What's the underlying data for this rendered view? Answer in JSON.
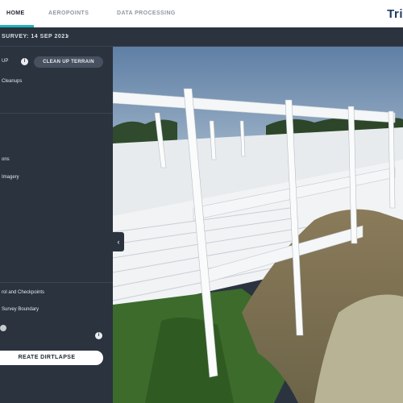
{
  "nav": {
    "tabs": [
      {
        "label": "HOME"
      },
      {
        "label": "AEROPOINTS"
      },
      {
        "label": "DATA PROCESSING"
      }
    ],
    "brand_fragment": "Tri"
  },
  "survey": {
    "label": "SURVEY: 14 SEP 2021",
    "caret": "▾"
  },
  "sidebar": {
    "header_fragment": "UP",
    "cleanup_button": "CLEAN UP TERRAIN",
    "items": [
      {
        "label": "Cleanups"
      },
      {
        "label": "ons"
      },
      {
        "label": "Imagery"
      },
      {
        "label": "rol and Checkpoints"
      },
      {
        "label": "Survey Boundary"
      }
    ],
    "info_glyph": "i",
    "dirtlapse_button": "REATE DIRTLAPSE",
    "collapse_glyph": "‹"
  },
  "colors": {
    "accent": "#1fb5b8",
    "sidebar_bg": "#2b333f",
    "brand": "#1d3b66"
  }
}
